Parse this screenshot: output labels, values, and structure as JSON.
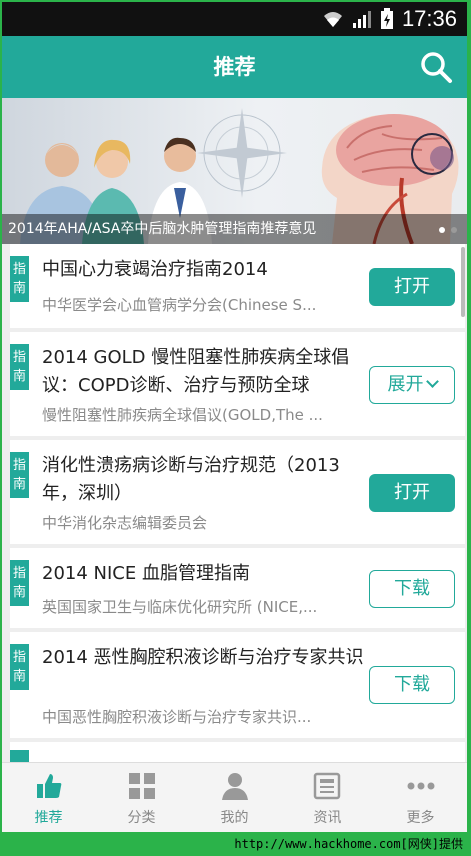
{
  "statusbar": {
    "time": "17:36"
  },
  "header": {
    "title": "推荐"
  },
  "banner": {
    "caption": "2014年AHA/ASA卒中后脑水肿管理指南推荐意见"
  },
  "list": {
    "items": [
      {
        "tag": "指南",
        "title": "中国心力衰竭治疗指南2014",
        "subtitle": "中华医学会心血管病学分会(Chinese S...",
        "action": "打开"
      },
      {
        "tag": "指南",
        "title": "2014 GOLD 慢性阻塞性肺疾病全球倡议：COPD诊断、治疗与预防全球",
        "subtitle": "慢性阻塞性肺疾病全球倡议(GOLD,The ...",
        "action": "展开"
      },
      {
        "tag": "指南",
        "title": "消化性溃疡病诊断与治疗规范（2013年，深圳）",
        "subtitle": "中华消化杂志编辑委员会",
        "action": "打开"
      },
      {
        "tag": "指南",
        "title": "2014 NICE 血脂管理指南",
        "subtitle": "英国国家卫生与临床优化研究所 (NICE,...",
        "action": "下载"
      },
      {
        "tag": "指南",
        "title": "2014 恶性胸腔积液诊断与治疗专家共识",
        "subtitle": "中国恶性胸腔积液诊断与治疗专家共识...",
        "action": "下载"
      }
    ]
  },
  "bottom_nav": {
    "items": [
      {
        "label": "推荐"
      },
      {
        "label": "分类"
      },
      {
        "label": "我的"
      },
      {
        "label": "资讯"
      },
      {
        "label": "更多"
      }
    ]
  },
  "watermark": "http://www.hackhome.com[网侠]提供",
  "colors": {
    "accent": "#22a99a",
    "frame": "#2bb34a"
  }
}
